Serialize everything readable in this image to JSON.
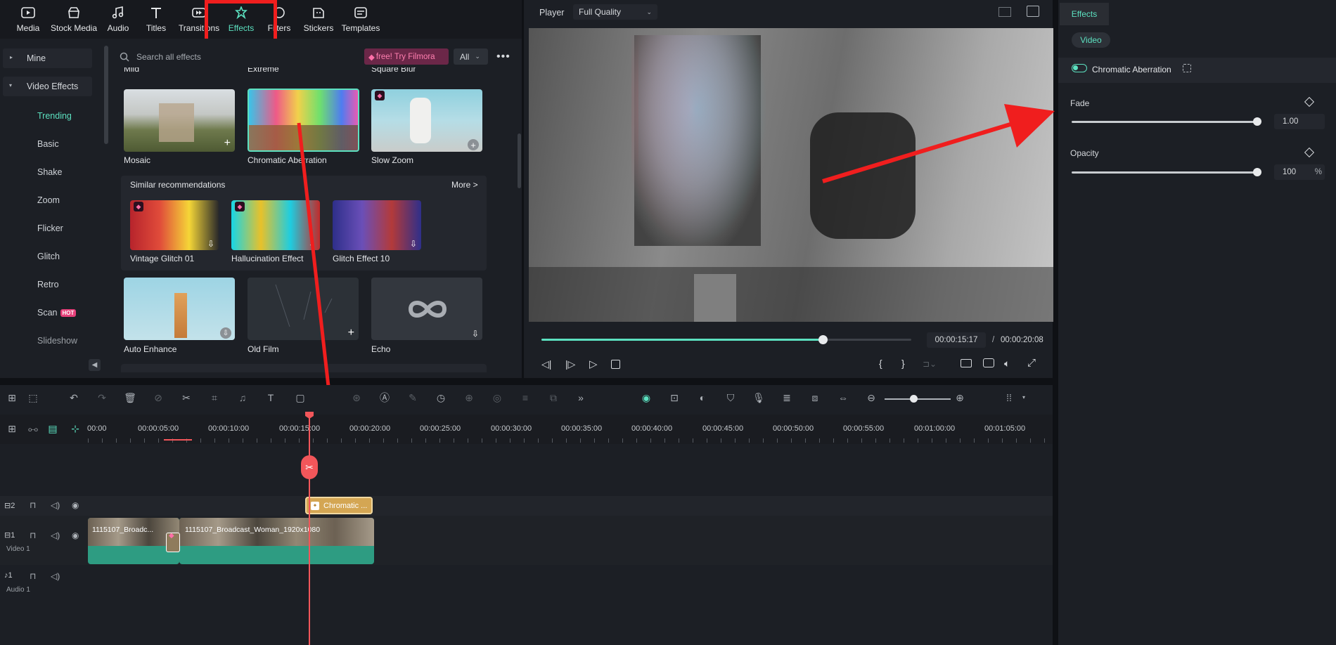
{
  "toolbar": {
    "items": [
      {
        "label": "Media",
        "icon": "media-icon"
      },
      {
        "label": "Stock Media",
        "icon": "stock-media-icon"
      },
      {
        "label": "Audio",
        "icon": "audio-icon"
      },
      {
        "label": "Titles",
        "icon": "titles-icon"
      },
      {
        "label": "Transitions",
        "icon": "transitions-icon"
      },
      {
        "label": "Effects",
        "icon": "effects-icon",
        "active": true
      },
      {
        "label": "Filters",
        "icon": "filters-icon"
      },
      {
        "label": "Stickers",
        "icon": "stickers-icon"
      },
      {
        "label": "Templates",
        "icon": "templates-icon"
      }
    ]
  },
  "leftnav": {
    "mine": "Mine",
    "video_effects": "Video Effects",
    "subs": [
      "Trending",
      "Basic",
      "Shake",
      "Zoom",
      "Flicker",
      "Glitch",
      "Retro",
      "Scan",
      "Slideshow"
    ],
    "hot_badge": "HOT"
  },
  "effects": {
    "search_placeholder": "Search all effects",
    "promo": "free! Try Filmora",
    "filter": "All",
    "partial_top": [
      "Mild",
      "Extreme",
      "Square Blur"
    ],
    "row1": [
      "Mosaic",
      "Chromatic Aberration",
      "Slow Zoom"
    ],
    "similar_title": "Similar recommendations",
    "more": "More >",
    "similar": [
      "Vintage Glitch 01",
      "Hallucination Effect",
      "Glitch Effect 10"
    ],
    "row2": [
      "Auto Enhance",
      "Old Film",
      "Echo"
    ]
  },
  "player": {
    "label": "Player",
    "quality": "Full Quality",
    "current_time": "00:00:15:17",
    "separator": "/",
    "total_time": "00:00:20:08",
    "progress": 0.76
  },
  "rightpanel": {
    "tab": "Effects",
    "subtab": "Video",
    "effect_name": "Chromatic Aberration",
    "params": [
      {
        "label": "Fade",
        "value": "1.00",
        "unit": "",
        "fill": 1.0
      },
      {
        "label": "Opacity",
        "value": "100",
        "unit": "%",
        "fill": 1.0
      }
    ]
  },
  "timeline": {
    "ruler": [
      "00:00",
      "00:00:05:00",
      "00:00:10:00",
      "00:00:15:00",
      "00:00:20:00",
      "00:00:25:00",
      "00:00:30:00",
      "00:00:35:00",
      "00:00:40:00",
      "00:00:45:00",
      "00:00:50:00",
      "00:00:55:00",
      "00:01:00:00",
      "00:01:05:00"
    ],
    "track2_num": "2",
    "track1_num": "1",
    "track1_name": "Video 1",
    "audio_num": "1",
    "audio_name": "Audio 1",
    "effect_clip": "Chromatic ...",
    "clip1": "1115107_Broadc...",
    "clip2": "1115107_Broadcast_Woman_1920x1080"
  },
  "colors": {
    "accent": "#5ce1c0",
    "highlight_red": "#f01e1e",
    "clip_teal": "#2e9c82",
    "effect_clip": "#d4a653",
    "playhead": "#f2565a"
  }
}
